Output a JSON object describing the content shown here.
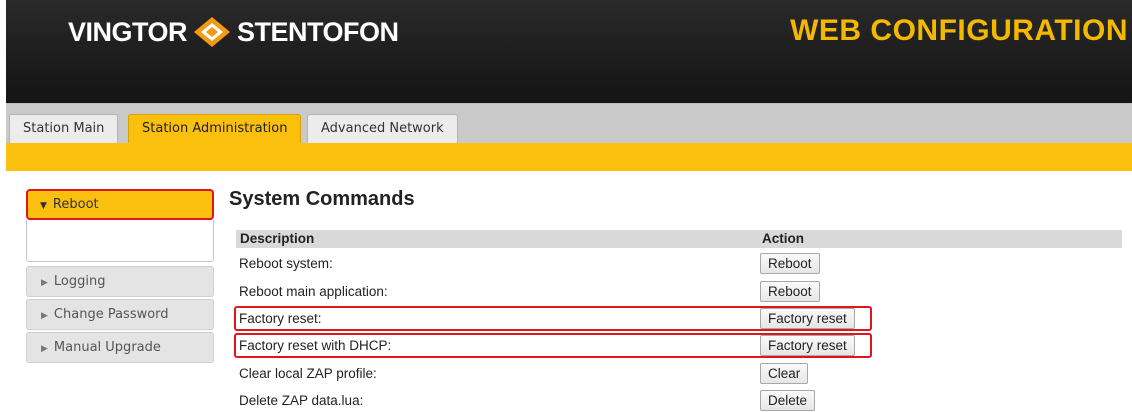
{
  "header": {
    "brand_left": "VINGTOR",
    "brand_right": "STENTOFON",
    "title": "WEB CONFIGURATION",
    "logo_icon": "orange-diamond-logo"
  },
  "tabs": [
    {
      "label": "Station Main",
      "active": false
    },
    {
      "label": "Station Administration",
      "active": true
    },
    {
      "label": "Advanced Network",
      "active": false
    }
  ],
  "sidebar": {
    "items": [
      {
        "label": "Reboot",
        "active": true
      },
      {
        "label": "Logging",
        "active": false
      },
      {
        "label": "Change Password",
        "active": false
      },
      {
        "label": "Manual Upgrade",
        "active": false
      }
    ]
  },
  "main": {
    "title": "System Commands",
    "columns": [
      "Description",
      "Action"
    ],
    "rows": [
      {
        "description": "Reboot system:",
        "action": "Reboot",
        "highlighted": false
      },
      {
        "description": "Reboot main application:",
        "action": "Reboot",
        "highlighted": false
      },
      {
        "description": "Factory reset:",
        "action": "Factory reset",
        "highlighted": true
      },
      {
        "description": "Factory reset with DHCP:",
        "action": "Factory reset",
        "highlighted": true
      },
      {
        "description": "Clear local ZAP profile:",
        "action": "Clear",
        "highlighted": false
      },
      {
        "description": "Delete ZAP data.lua:",
        "action": "Delete",
        "highlighted": false
      }
    ]
  },
  "colors": {
    "accent": "#fbbf0d",
    "highlight": "#e0161e",
    "header_bg": "#1e1e1e",
    "title_text": "#f5b800"
  }
}
